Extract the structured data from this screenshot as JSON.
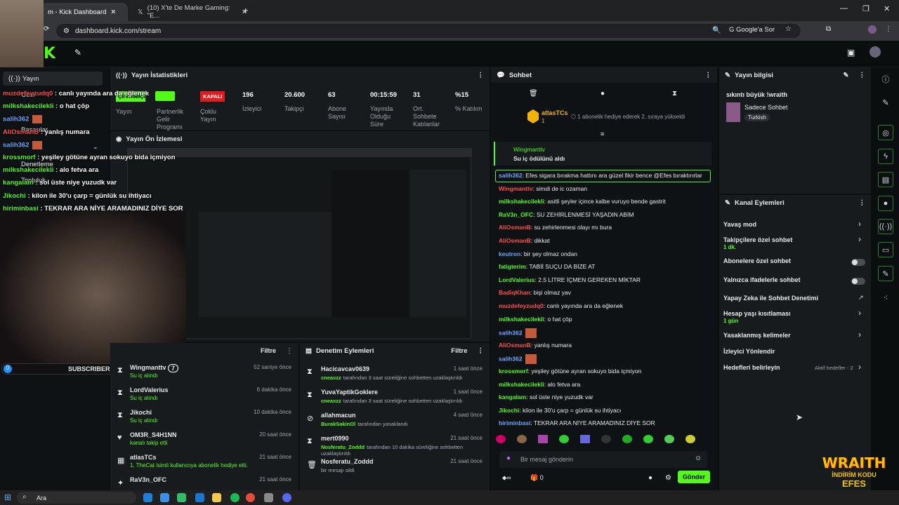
{
  "browser": {
    "tabs": [
      {
        "title": "m - Kick Dashboard"
      },
      {
        "title": "(10) X'te De Marke Gaming: \"E..."
      }
    ],
    "url": "dashboard.kick.com/stream",
    "google_btn": "Google'a Sor"
  },
  "sidebar_left": {
    "items": [
      "Yayın",
      "Gelir",
      "Başarılar",
      "Denetleme",
      "Topluluk"
    ]
  },
  "stats": {
    "title": "Yayın İstatistikleri",
    "items": [
      {
        "v": "ÇEVRİMİÇİ",
        "l": "Yayın"
      },
      {
        "v": "",
        "l": "Partnerlik Gelir Programı"
      },
      {
        "v": "KAPALI",
        "l": "Çoklu Yayın"
      },
      {
        "v": "196",
        "l": "İzleyici"
      },
      {
        "v": "20.600",
        "l": "Takipçi"
      },
      {
        "v": "63",
        "l": "Abone Sayısı"
      },
      {
        "v": "00:15:59",
        "l": "Yayında Olduğu Süre"
      },
      {
        "v": "31",
        "l": "Ort. Sohbete Katılanlar"
      },
      {
        "v": "%15",
        "l": "% Katılım"
      }
    ]
  },
  "preview": {
    "title": "Yayın Ön İzlemesi"
  },
  "feed_left": {
    "filter": "Filtre",
    "items": [
      {
        "name": "Wingmanttv",
        "badge": "7",
        "sub": "Su iç alındı",
        "time": "52 saniye önce"
      },
      {
        "name": "LordValerius",
        "sub": "Su iç alındı",
        "time": "6 dakika önce"
      },
      {
        "name": "Jikochi",
        "sub": "Su iç alındı",
        "time": "10 dakika önce"
      },
      {
        "name": "OM3R_S4H1NN",
        "sub": "kanalı takip etti",
        "time": "20 saat önce"
      },
      {
        "name": "atlasTCs",
        "sub": "1, TheCat isimli kullanıcıya abonelik hediye etti.",
        "time": "21 saat önce"
      },
      {
        "name": "RaV3n_OFC",
        "sub": "",
        "time": "21 saat önce"
      }
    ]
  },
  "mod_actions": {
    "title": "Denetim Eylemleri",
    "filter": "Filtre",
    "items": [
      {
        "name": "Hacicavcav0639",
        "by": "cneaxzz",
        "txt": "tarafından 3 saat süreliğine sohbetten uzaklaştırıldı",
        "time": "1 saat önce"
      },
      {
        "name": "YuvaYaptikGoklere",
        "by": "cneaxzz",
        "txt": "tarafından 3 saat süreliğine sohbetten uzaklaştırıldı",
        "time": "1 saat önce"
      },
      {
        "name": "allahmacun",
        "by": "BurakSakinOl",
        "txt": "tarafından yasaklandı",
        "time": "4 saat önce"
      },
      {
        "name": "mert0990",
        "by": "Nosferatu_Zoddd",
        "txt": "tarafından 10 dakika süreliğine sohbetten uzaklaştırıldı",
        "time": "21 saat önce"
      },
      {
        "name": "Nosferatu_Zoddd",
        "by": "",
        "txt": "bir mesajı sildi",
        "time": "21 saat önce"
      }
    ]
  },
  "chat": {
    "title": "Sohbet",
    "pinned_user": "atlasTCs",
    "pinned_count": "1",
    "pinned_text": "1 abonelik hediye ederek 2. sıraya yükseldi",
    "reward_user": "Wingmanttv",
    "reward_text": "Su iç ödülünü aldı",
    "messages": [
      {
        "u": "salih362",
        "c": "#6aa9ff",
        "t": "Efes sigara bırakma hattını ara güzel fikir bence @Efes bıraktırırlar"
      },
      {
        "u": "Wingmanttv",
        "c": "#ff4d4d",
        "t": "simdi de ic ozaman"
      },
      {
        "u": "milkshakecilekli",
        "c": "#53fc18",
        "t": "asitli şeyler içince kalbe vuruyo bende gastrit"
      },
      {
        "u": "RaV3n_OFC",
        "c": "#53fc18",
        "t": "SU ZEHİRLENMESİ YAŞADIN ABİM"
      },
      {
        "u": "AliOsmanB",
        "c": "#ff4d4d",
        "t": "su zehirlenmesi olayı mı bura"
      },
      {
        "u": "AliOsmanB",
        "c": "#ff4d4d",
        "t": "dikkat"
      },
      {
        "u": "keutron",
        "c": "#6aa9ff",
        "t": "bir şey olmaz ondan"
      },
      {
        "u": "fatigterim",
        "c": "#53fc18",
        "t": "TABİİ SUÇU DA BİZE AT"
      },
      {
        "u": "LordValerius",
        "c": "#53fc18",
        "t": "2.5 LİTRE İÇMEN GEREKEN MİKTAR"
      },
      {
        "u": "BadiqKhan",
        "c": "#ff4d4d",
        "t": "bişi olmaz yav"
      },
      {
        "u": "muzdefeyzudq0",
        "c": "#ff4d4d",
        "t": "canlı yayında ara da eğlenek"
      },
      {
        "u": "milkshakecilekli",
        "c": "#53fc18",
        "t": "o hat çöp"
      },
      {
        "u": "salih362",
        "c": "#6aa9ff",
        "t": ""
      },
      {
        "u": "AliOsmanB",
        "c": "#ff4d4d",
        "t": "yanlış numara"
      },
      {
        "u": "salih362",
        "c": "#6aa9ff",
        "t": ""
      },
      {
        "u": "krossmorf",
        "c": "#53fc18",
        "t": "yeşiley götüne ayran sokuyo bida içmiyon"
      },
      {
        "u": "milkshakecilekli",
        "c": "#53fc18",
        "t": "alo fetva ara"
      },
      {
        "u": "kangalam",
        "c": "#53fc18",
        "t": "sol üste niye yuzudk var"
      },
      {
        "u": "Jikochi",
        "c": "#53fc18",
        "t": "kilon ile 30'u çarp = günlük su ihtiyacı"
      },
      {
        "u": "hiriminbasi",
        "c": "#6aa9ff",
        "t": "TEKRAR ARA NİYE ARAMADINIZ DİYE SOR"
      }
    ],
    "input_placeholder": "Bir mesaj gönderin",
    "points": "0",
    "send": "Gönder"
  },
  "stream_info": {
    "title": "Yayın bilgisi",
    "stream_title": "sıkıntı büyük !wraith",
    "category": "Sadece Sohbet",
    "language": "Turkish"
  },
  "channel_actions": {
    "title": "Kanal Eylemleri",
    "items": [
      {
        "label": "Yavaş mod",
        "sub": ""
      },
      {
        "label": "Takipçilere özel sohbet",
        "sub": "1 dk."
      },
      {
        "label": "Abonelere özel sohbet",
        "sub": ""
      },
      {
        "label": "Yalnızca ifadelerle sohbet",
        "sub": ""
      },
      {
        "label": "Yapay Zeka ile Sohbet Denetimi",
        "sub": ""
      },
      {
        "label": "Hesap yaşı kısıtlaması",
        "sub": "1 gün"
      },
      {
        "label": "Yasaklanmış kelimeler",
        "sub": ""
      },
      {
        "label": "İzleyici Yönlendir",
        "sub": ""
      },
      {
        "label": "Hedefleri belirleyin",
        "sub": "Aktif hedefler - 2"
      }
    ]
  },
  "overlay": {
    "subs_count": "0",
    "subs_label": "SUBSCRIBERS",
    "wraith": "WRAITH",
    "promo": "İNDİRİM KODU",
    "code": "EFES",
    "chat_lines": [
      {
        "u": "muzdefeyzudq0",
        "c": "#ff4d4d",
        "t": "canlı yayında ara da eğlenek"
      },
      {
        "u": "milkshakecilekli",
        "c": "#53fc18",
        "t": "o hat çöp"
      },
      {
        "u": "salih362",
        "c": "#6aa9ff",
        "t": ""
      },
      {
        "u": "AliOsmanB",
        "c": "#ff4d4d",
        "t": "yanlış numara"
      },
      {
        "u": "salih362",
        "c": "#6aa9ff",
        "t": ""
      },
      {
        "u": "krossmorf",
        "c": "#53fc18",
        "t": "yeşiley götüne ayran sokuyo bida içmiyon"
      },
      {
        "u": "milkshakecilekli",
        "c": "#53fc18",
        "t": "alo fetva ara"
      },
      {
        "u": "kangalam",
        "c": "#53fc18",
        "t": "sol üste niye yuzudk var"
      },
      {
        "u": "Jikochi",
        "c": "#53fc18",
        "t": "kilon ile 30'u çarp = günlük su ihtiyacı"
      },
      {
        "u": "hiriminbasi",
        "c": "#53fc18",
        "t": "TEKRAR ARA NİYE ARAMADINIZ DİYE SOR"
      }
    ]
  },
  "taskbar": {
    "search": "Ara"
  }
}
